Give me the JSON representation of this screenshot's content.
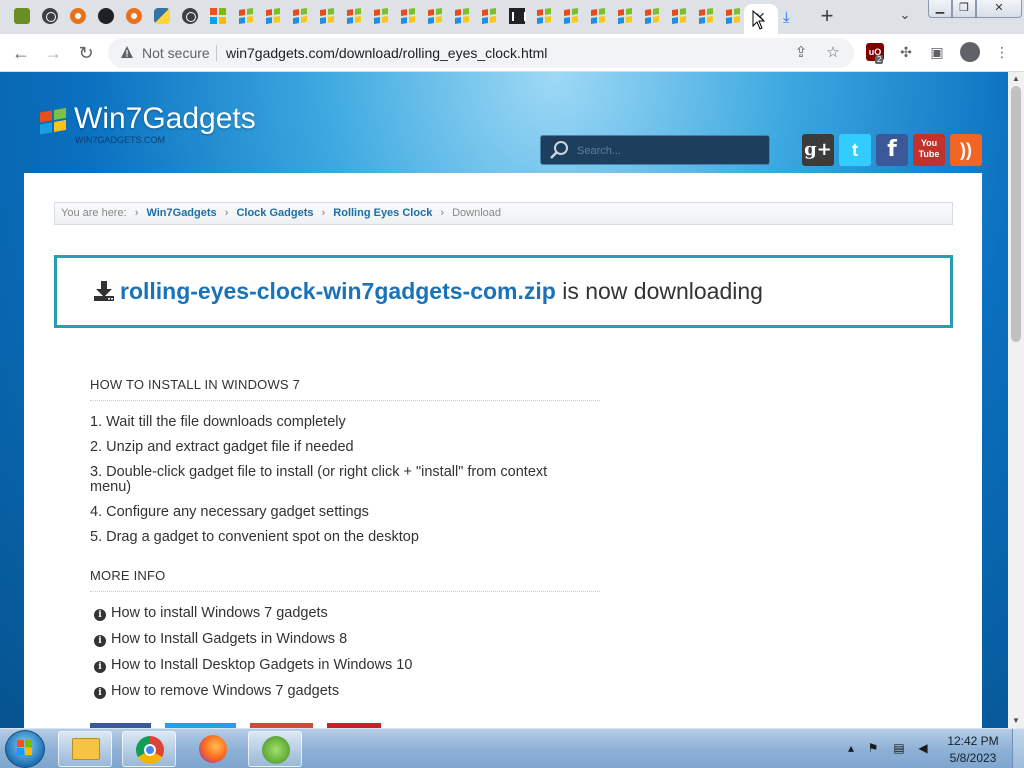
{
  "browser": {
    "tabs": [
      {
        "icon": "green-leaf-icon"
      },
      {
        "icon": "globe-icon"
      },
      {
        "icon": "gear-icon"
      },
      {
        "icon": "github-icon"
      },
      {
        "icon": "gear-icon"
      },
      {
        "icon": "python-icon"
      },
      {
        "icon": "globe-icon"
      },
      {
        "icon": "microsoft-icon"
      },
      {
        "icon": "win7gadgets-icon"
      },
      {
        "icon": "win7gadgets-icon"
      },
      {
        "icon": "win7gadgets-icon"
      },
      {
        "icon": "win7gadgets-icon"
      },
      {
        "icon": "win7gadgets-icon"
      },
      {
        "icon": "win7gadgets-icon"
      },
      {
        "icon": "win7gadgets-icon"
      },
      {
        "icon": "win7gadgets-icon"
      },
      {
        "icon": "win7gadgets-icon"
      },
      {
        "icon": "museum-icon"
      },
      {
        "icon": "win7gadgets-icon"
      },
      {
        "icon": "win7gadgets-icon"
      },
      {
        "icon": "win7gadgets-icon"
      },
      {
        "icon": "win7gadgets-icon"
      },
      {
        "icon": "win7gadgets-icon"
      },
      {
        "icon": "win7gadgets-icon"
      },
      {
        "icon": "win7gadgets-icon"
      },
      {
        "icon": "win7gadgets-icon"
      },
      {
        "icon": "close-icon",
        "active": true
      },
      {
        "icon": "download-icon"
      }
    ],
    "new_tab_label": "+",
    "security_label": "Not secure",
    "url": "win7gadgets.com/download/rolling_eyes_clock.html",
    "extension_badge": "2"
  },
  "site": {
    "logo_title": "Win7Gadgets",
    "logo_subtitle": "WIN7GADGETS.COM",
    "search_placeholder": "Search...",
    "social": {
      "gplus": "g+",
      "twitter": "t",
      "facebook": "f",
      "youtube_top": "You",
      "youtube_bottom": "Tube",
      "rss": "))"
    },
    "colors": {
      "accent": "#1a73b8",
      "box_border": "#2b9cb6"
    }
  },
  "breadcrumb": {
    "prefix": "You are here:",
    "items": [
      "Win7Gadgets",
      "Clock Gadgets",
      "Rolling Eyes Clock"
    ],
    "current": "Download"
  },
  "download": {
    "filename": "rolling-eyes-clock-win7gadgets-com.zip",
    "status": "is now downloading"
  },
  "install": {
    "title": "HOW TO INSTALL IN WINDOWS 7",
    "steps": [
      "1. Wait till the file downloads completely",
      "2. Unzip and extract gadget file if needed",
      "3. Double-click gadget file to install (or right click + \"install\" from context menu)",
      "4. Configure any necessary gadget settings",
      "5. Drag a gadget to convenient spot on the desktop"
    ]
  },
  "more_info": {
    "title": "MORE INFO",
    "links": [
      "How to install Windows 7 gadgets",
      "How to Install Gadgets in Windows 8",
      "How to Install Desktop Gadgets in Windows 10",
      "How to remove Windows 7 gadgets"
    ]
  },
  "taskbar": {
    "apps": [
      "windows-explorer",
      "google-chrome",
      "firefox",
      "desktop-gadgets"
    ],
    "time": "12:42 PM",
    "date": "5/8/2023"
  }
}
